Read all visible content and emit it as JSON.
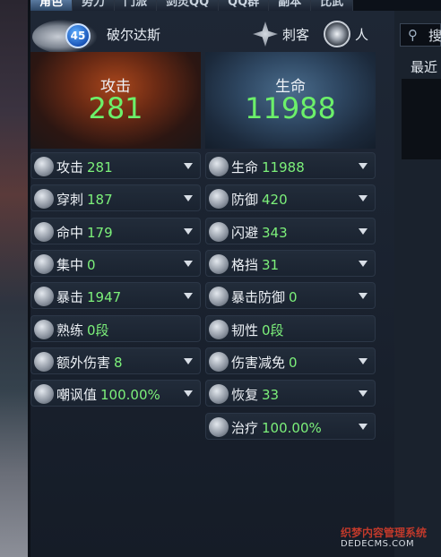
{
  "tabs": [
    "角色",
    "势力",
    "门派",
    "剑灵QQ",
    "QQ群",
    "副本",
    "比武"
  ],
  "character": {
    "level": "45",
    "name": "破尔达斯",
    "class": "刺客",
    "race": "人"
  },
  "search": {
    "placeholder": "搜"
  },
  "recent_label": "最近",
  "attack_card": {
    "title": "攻击",
    "value": "281"
  },
  "hp_card": {
    "title": "生命",
    "value": "11988"
  },
  "attack_stats": [
    {
      "label": "攻击",
      "value": "281",
      "icon": "swords-icon"
    },
    {
      "label": "穿刺",
      "value": "187",
      "icon": "pierce-icon"
    },
    {
      "label": "命中",
      "value": "179",
      "icon": "accuracy-icon"
    },
    {
      "label": "集中",
      "value": "0",
      "icon": "focus-icon"
    },
    {
      "label": "暴击",
      "value": "1947",
      "icon": "critical-icon"
    },
    {
      "label": "熟练",
      "value": "0段",
      "icon": "mastery-icon"
    },
    {
      "label": "额外伤害",
      "value": "8",
      "icon": "additional-damage-icon"
    },
    {
      "label": "嘲讽值",
      "value": "100.00%",
      "icon": "skull-icon"
    }
  ],
  "defense_stats": [
    {
      "label": "生命",
      "value": "11988",
      "icon": "heart-icon"
    },
    {
      "label": "防御",
      "value": "420",
      "icon": "shield-icon"
    },
    {
      "label": "闪避",
      "value": "343",
      "icon": "evasion-icon"
    },
    {
      "label": "格挡",
      "value": "31",
      "icon": "block-icon"
    },
    {
      "label": "暴击防御",
      "value": "0",
      "icon": "critical-defense-icon"
    },
    {
      "label": "韧性",
      "value": "0段",
      "icon": "toughness-icon"
    },
    {
      "label": "伤害减免",
      "value": "0",
      "icon": "damage-reduction-icon"
    },
    {
      "label": "恢复",
      "value": "33",
      "icon": "regen-icon"
    },
    {
      "label": "治疗",
      "value": "100.00%",
      "icon": "heal-icon"
    }
  ],
  "watermark": {
    "line1": "织梦内容管理系统",
    "line2": "DEDECMS.COM"
  }
}
